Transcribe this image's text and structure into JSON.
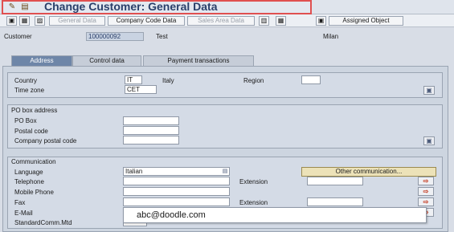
{
  "window": {
    "title": "Change Customer: General Data"
  },
  "toolbar": {
    "general_data": "General Data",
    "company_code_data": "Company Code Data",
    "sales_area_data": "Sales Area Data",
    "assigned_object": "Assigned Object"
  },
  "header": {
    "customer_label": "Customer",
    "customer_number": "100000092",
    "name": "Test",
    "city": "Milan"
  },
  "tabs": [
    {
      "label": "Address",
      "active": true
    },
    {
      "label": "Control data",
      "active": false
    },
    {
      "label": "Payment transactions",
      "active": false
    }
  ],
  "location": {
    "country_label": "Country",
    "country_value": "IT",
    "country_name": "Italy",
    "region_label": "Region",
    "region_value": "",
    "time_zone_label": "Time zone",
    "time_zone_value": "CET"
  },
  "po_box": {
    "title": "PO box address",
    "po_box_label": "PO Box",
    "po_box_value": "",
    "postal_code_label": "Postal code",
    "postal_code_value": "",
    "company_postal_code_label": "Company postal code",
    "company_postal_code_value": ""
  },
  "communication": {
    "title": "Communication",
    "language_label": "Language",
    "language_value": "Italian",
    "telephone_label": "Telephone",
    "telephone_value": "",
    "extension_label": "Extension",
    "extension_value": "",
    "mobile_label": "Mobile Phone",
    "mobile_value": "",
    "fax_label": "Fax",
    "fax_value": "",
    "fax_extension_label": "Extension",
    "fax_extension_value": "",
    "email_label": "E-Mail",
    "email_value": "abc@doodle.com",
    "std_comm_label": "StandardComm.Mtd",
    "other_communication": "Other communication..."
  },
  "icons": {
    "save": "save-icon",
    "display_change": "display-change-icon",
    "other_object": "other-object-icon",
    "detail": "detail-icon",
    "select": "select-icon",
    "arrow": "arrow-icon"
  },
  "colors": {
    "title_text": "#2a3f6a",
    "highlight_border": "#e05050",
    "active_tab": "#6e86a8",
    "other_comm_button": "#ece2b8"
  }
}
